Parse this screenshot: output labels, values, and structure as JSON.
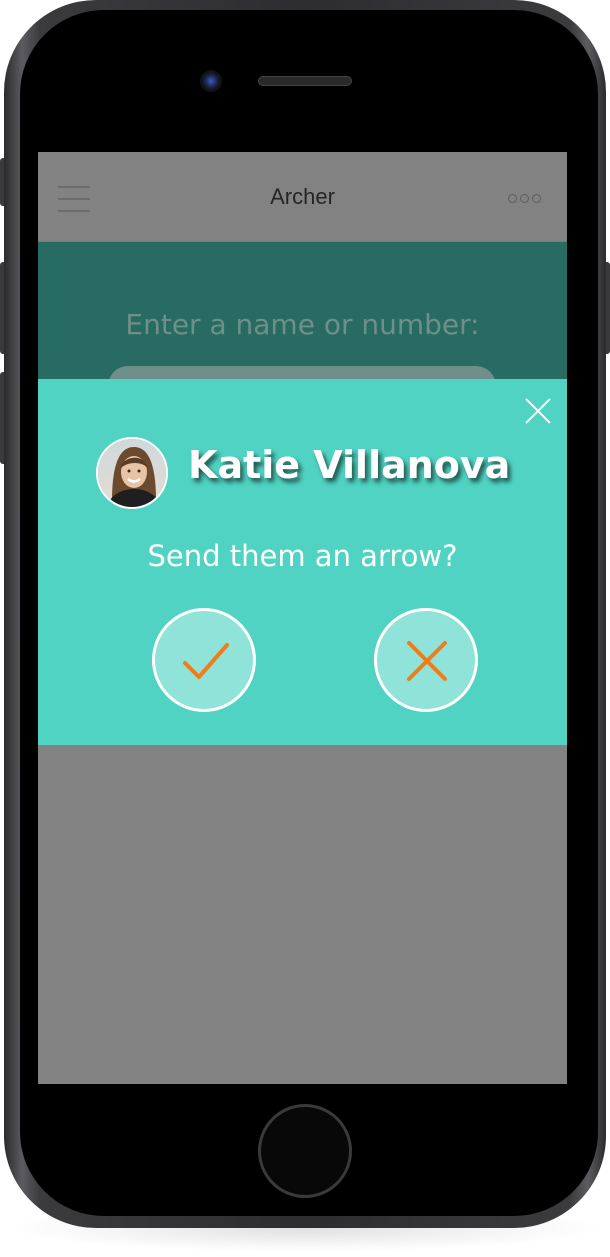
{
  "app": {
    "title": "Archer"
  },
  "entry": {
    "prompt": "Enter a name or number:",
    "input_value": ""
  },
  "modal": {
    "contact_name": "Katie Villanova",
    "question": "Send them an arrow?",
    "confirm_icon": "checkmark-icon",
    "cancel_icon": "x-icon",
    "close_icon": "close-icon"
  },
  "colors": {
    "modal_background": "#50d3c3",
    "entry_background": "#276b62",
    "overlay_gray": "#828282",
    "action_accent": "#f07d1a"
  }
}
